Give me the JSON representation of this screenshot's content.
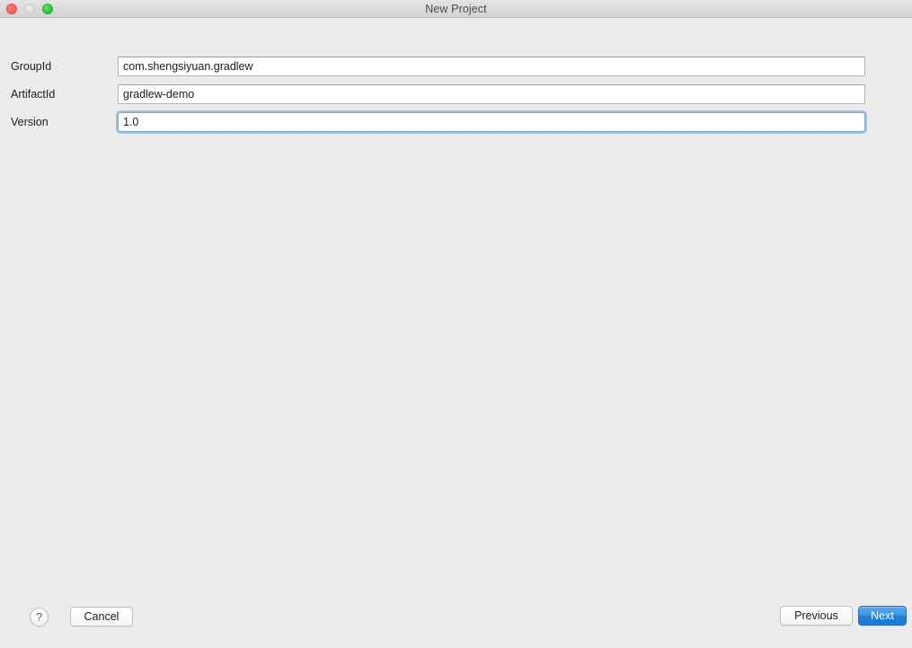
{
  "window": {
    "title": "New Project",
    "traffic_lights": [
      {
        "name": "close",
        "color": "#f6655c",
        "enabled": true
      },
      {
        "name": "minimize",
        "color": "#dddddd",
        "enabled": false
      },
      {
        "name": "maximize",
        "color": "#38c840",
        "enabled": true
      }
    ],
    "background_color": "#ececec"
  },
  "form": {
    "fields": [
      {
        "label": "GroupId",
        "value": "com.shengsiyuan.gradlew",
        "placeholder": "",
        "focused": false
      },
      {
        "label": "ArtifactId",
        "value": "gradlew-demo",
        "placeholder": "",
        "focused": false
      },
      {
        "label": "Version",
        "value": "1.0",
        "placeholder": "",
        "focused": true
      }
    ]
  },
  "footer": {
    "help_label": "?",
    "cancel_label": "Cancel",
    "previous_label": "Previous",
    "next_label": "Next",
    "accent_color": "#2180d8",
    "help_glyph_color": "#3b6ea8"
  }
}
